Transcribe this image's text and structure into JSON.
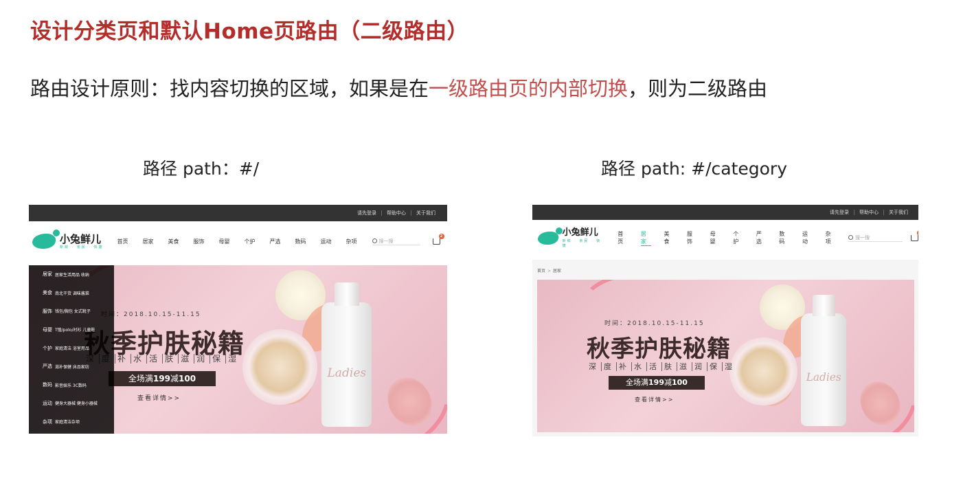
{
  "title": "设计分类页和默认Home页路由（二级路由）",
  "principle": {
    "prefix": "路由设计原则：找内容切换的区域，如果是在",
    "highlight": "一级路由页的内部切换",
    "suffix": "，则为二级路由"
  },
  "left": {
    "path_label": "路径 path：#/",
    "topbar": [
      "请先登录",
      "帮助中心",
      "关于我们"
    ],
    "brand": "小兔鲜儿",
    "brand_tag": "新鲜 · 亲民 · 快捷",
    "nav": [
      "首页",
      "居家",
      "美食",
      "服饰",
      "母婴",
      "个护",
      "严选",
      "数码",
      "运动",
      "杂项"
    ],
    "active_nav": "",
    "search_placeholder": "搜一搜",
    "cart_count": "2",
    "categories": [
      {
        "name": "居家",
        "sub": "居家生活用品 收纳"
      },
      {
        "name": "美食",
        "sub": "南北干货 调味酱菜"
      },
      {
        "name": "服饰",
        "sub": "钱包/胸包 女式靴子"
      },
      {
        "name": "母婴",
        "sub": "T恤/polo/衬衫 儿童鞋"
      },
      {
        "name": "个护",
        "sub": "家庭清洁 浴室用品"
      },
      {
        "name": "严选",
        "sub": "滋补保健 床品家纺"
      },
      {
        "name": "数码",
        "sub": "影音娱乐 3C数码"
      },
      {
        "name": "运动",
        "sub": "健身大器械 健身小器械"
      },
      {
        "name": "杂项",
        "sub": "家庭清洁杂项"
      }
    ]
  },
  "right": {
    "path_label": "路径 path: #/category",
    "topbar": [
      "请先登录",
      "帮助中心",
      "关于我们"
    ],
    "brand": "小兔鲜儿",
    "brand_tag": "新鲜 · 亲民 · 快捷",
    "nav": [
      "首页",
      "居家",
      "美食",
      "服饰",
      "母婴",
      "个护",
      "严选",
      "数码",
      "运动",
      "杂项"
    ],
    "active_nav": "居家",
    "search_placeholder": "搜一搜",
    "cart_count": "2",
    "breadcrumb": [
      "首页",
      "居家"
    ],
    "breadcrumb_sep": ">"
  },
  "banner": {
    "time": "时间：2018.10.15-11.15",
    "headline": "秋季护肤秘籍",
    "features": [
      "深",
      "度",
      "补",
      "水",
      "活",
      "肤",
      "滋",
      "润",
      "保",
      "湿"
    ],
    "promo_prefix": "全场满",
    "promo_a": "199",
    "promo_mid": "减",
    "promo_b": "100",
    "more": "查看详情>>",
    "bottle_label": "Ladies"
  },
  "colors": {
    "title": "#b32d2a",
    "highlight": "#c24e4c",
    "brand": "#27ba9b",
    "cart_badge": "#e26237"
  }
}
